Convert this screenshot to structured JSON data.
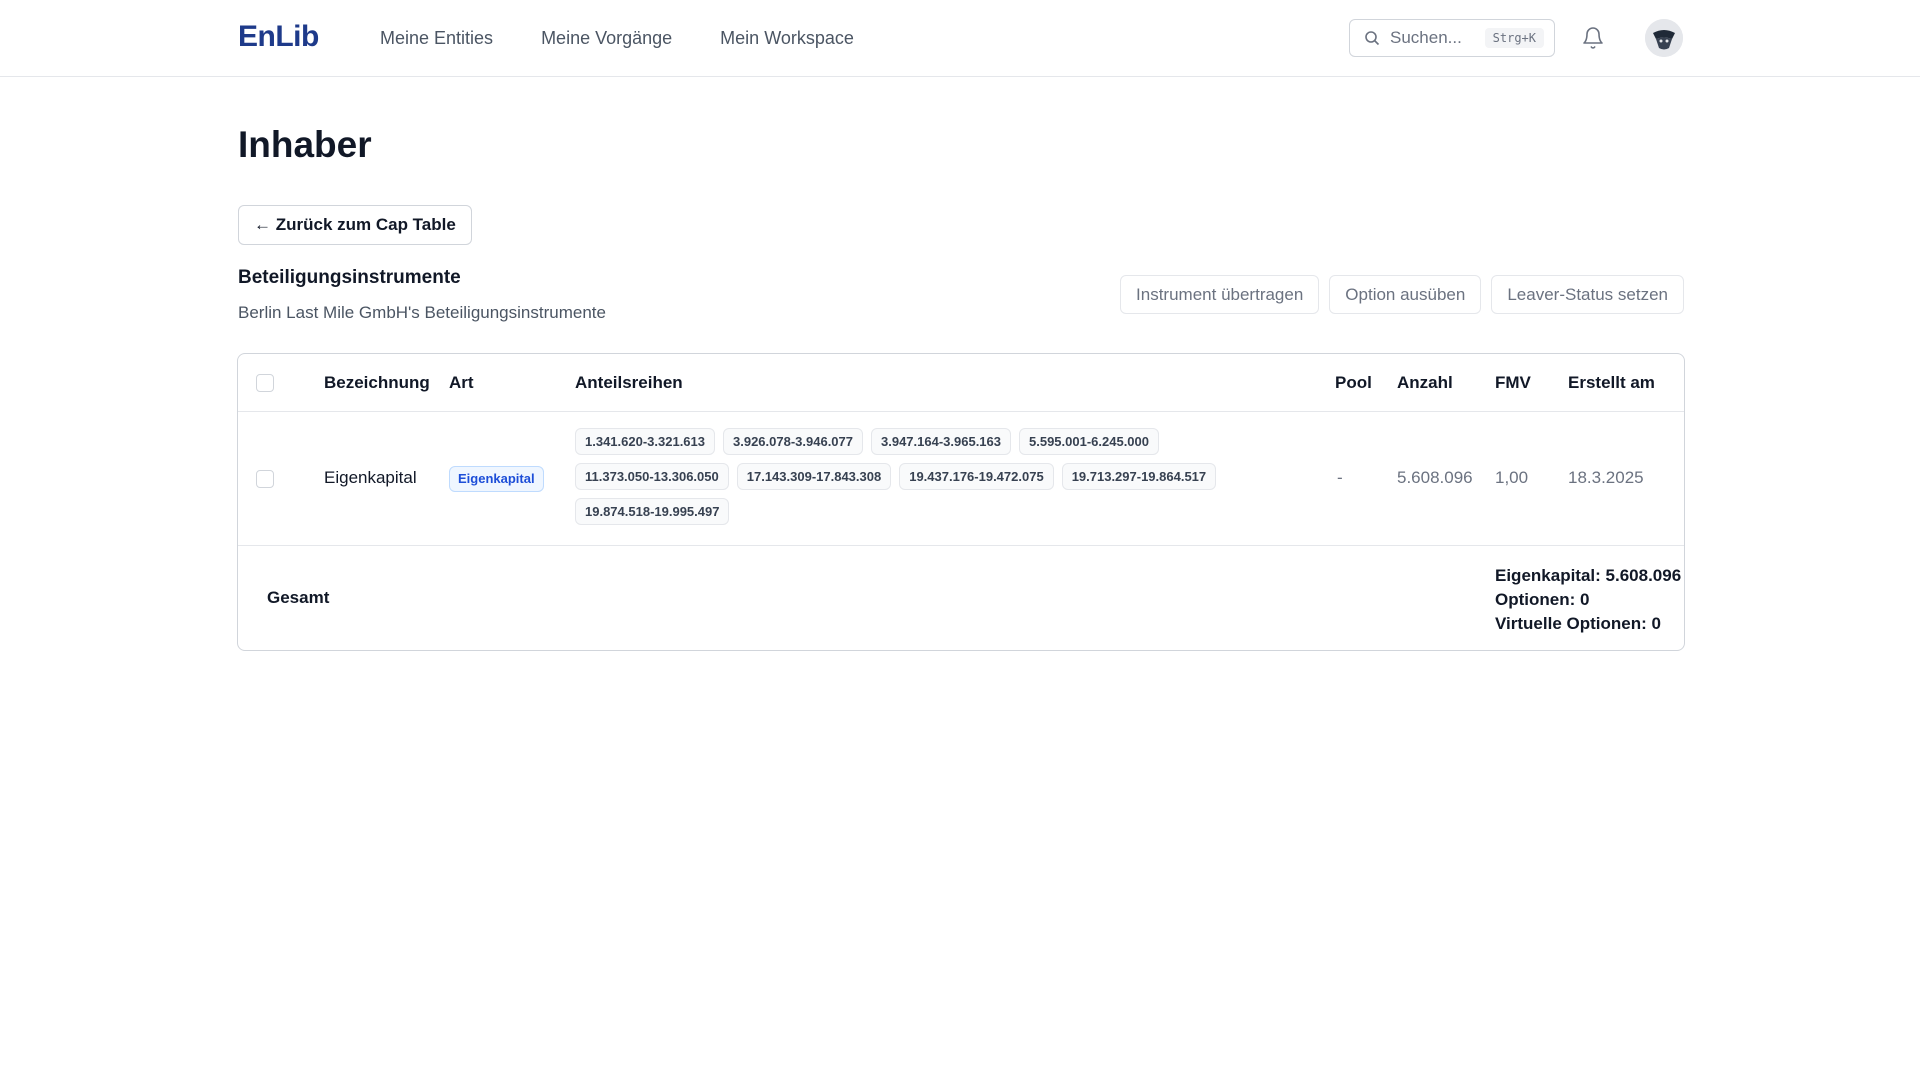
{
  "header": {
    "logo": "EnLib",
    "nav": [
      "Meine Entities",
      "Meine Vorgänge",
      "Mein Workspace"
    ],
    "search_placeholder": "Suchen...",
    "search_shortcut": "Strg+K"
  },
  "page": {
    "title": "Inhaber",
    "back_label": "← Zurück zum Cap Table",
    "section_title": "Beteiligungsinstrumente",
    "section_subtitle": "Berlin Last Mile GmbH's Beteiligungsinstrumente",
    "actions": [
      "Instrument übertragen",
      "Option ausüben",
      "Leaver-Status setzen"
    ]
  },
  "table": {
    "columns": [
      "Bezeichnung",
      "Art",
      "Anteilsreihen",
      "Pool",
      "Anzahl",
      "FMV",
      "Erstellt am"
    ],
    "rows": [
      {
        "bezeichnung": "Eigenkapital",
        "art": "Eigenkapital",
        "anteilsreihen": [
          "1.341.620-3.321.613",
          "3.926.078-3.946.077",
          "3.947.164-3.965.163",
          "5.595.001-6.245.000",
          "11.373.050-13.306.050",
          "17.143.309-17.843.308",
          "19.437.176-19.472.075",
          "19.713.297-19.864.517",
          "19.874.518-19.995.497"
        ],
        "pool": "-",
        "anzahl": "5.608.096",
        "fmv": "1,00",
        "erstellt_am": "18.3.2025"
      }
    ],
    "footer": {
      "label": "Gesamt",
      "totals": [
        "Eigenkapital: 5.608.096",
        "Optionen: 0",
        "Virtuelle Optionen: 0"
      ]
    }
  },
  "colors": {
    "brand": "#1e3a8a",
    "badge_bg": "#eff6ff",
    "badge_text": "#1d4ed8"
  }
}
